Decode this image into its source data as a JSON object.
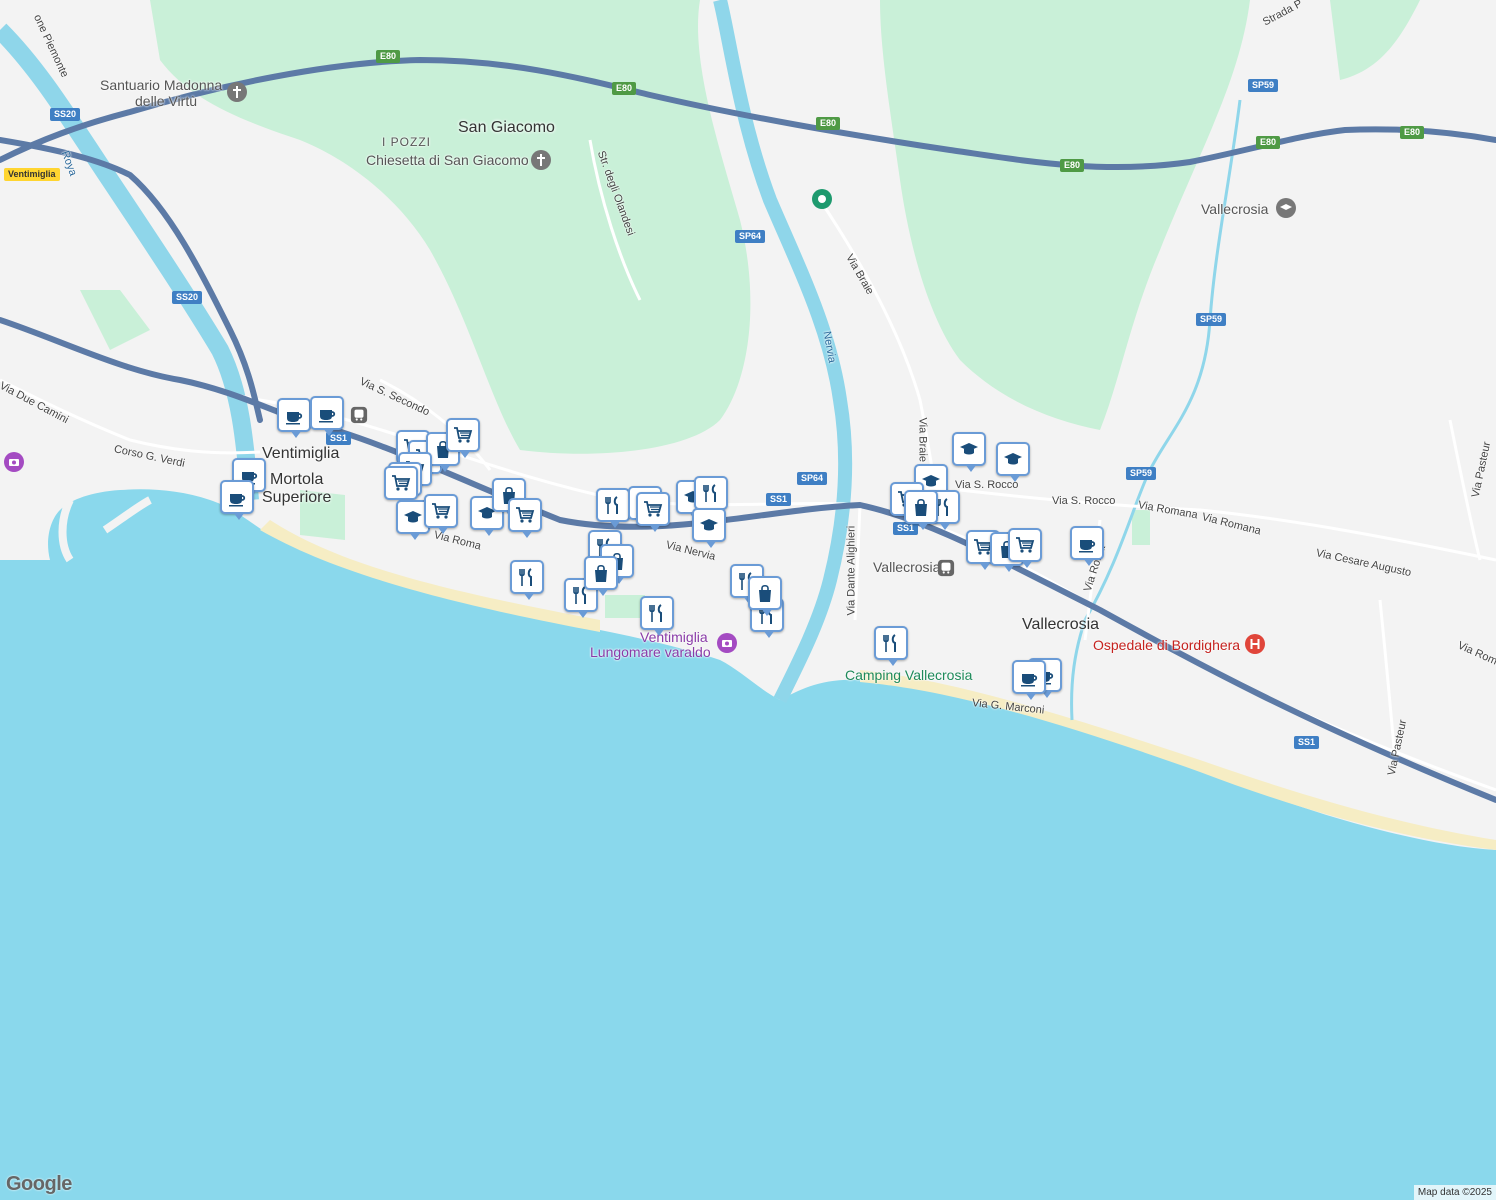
{
  "map": {
    "colors": {
      "sea": "#8ad8ec",
      "land": "#f3f3f3",
      "forest": "#c9f0d8",
      "river": "#8fd6ea",
      "highway": "#5c7aa6",
      "road": "#ffffff",
      "beach": "#f6edc4",
      "marker_border": "#6a9bd6",
      "marker_icon": "#1a4d7a"
    },
    "places": [
      {
        "name": "Ventimiglia",
        "kind": "city"
      },
      {
        "name": "Mortola",
        "kind": "town"
      },
      {
        "name": "Superiore",
        "kind": "town"
      },
      {
        "name": "San Giacomo",
        "kind": "town"
      },
      {
        "name": "I POZZI",
        "kind": "area"
      },
      {
        "name": "Vallecrosia",
        "kind": "city"
      }
    ],
    "pois": [
      {
        "name": "Santuario Madonna",
        "icon": "church-icon"
      },
      {
        "name": "delle Virtù",
        "icon": "church-icon"
      },
      {
        "name": "Chiesetta di San Giacomo",
        "icon": "church-icon"
      },
      {
        "name": "Vallecrosia",
        "icon": "school-icon"
      },
      {
        "name": "Ventimiglia",
        "icon": "camera-icon"
      },
      {
        "name": "Lungomare varaldo",
        "icon": "camera-icon"
      },
      {
        "name": "Ospedale di Bordighera",
        "icon": "hospital-icon"
      },
      {
        "name": "Camping Vallecrosia",
        "icon": "camping-icon"
      },
      {
        "name": "Vallecrosia",
        "icon": "train-station-icon"
      }
    ],
    "streets": [
      "Via Due Camini",
      "Corso G. Verdi",
      "Via S. Secondo",
      "Via Roma",
      "Via Nervia",
      "Str. degli Olandesi",
      "Via Braie",
      "Via Braie",
      "Via Dante Alighieri",
      "Via S. Rocco",
      "Via S. Rocco",
      "Via Romana",
      "Via Romana",
      "Via Cesare Augusto",
      "Via G. Marconi",
      "Via Pasteur",
      "Via Pasteur",
      "Via Roma",
      "Strada P",
      "Nervia",
      "Roya",
      "one Piemonte",
      "Via Roma"
    ],
    "shields": [
      {
        "label": "E80",
        "color": "green"
      },
      {
        "label": "E80",
        "color": "green"
      },
      {
        "label": "E80",
        "color": "green"
      },
      {
        "label": "E80",
        "color": "green"
      },
      {
        "label": "E80",
        "color": "green"
      },
      {
        "label": "E80",
        "color": "green"
      },
      {
        "label": "SS20",
        "color": "blue"
      },
      {
        "label": "SS20",
        "color": "blue"
      },
      {
        "label": "SS1",
        "color": "blue"
      },
      {
        "label": "SS1",
        "color": "blue"
      },
      {
        "label": "SS1",
        "color": "blue"
      },
      {
        "label": "SS1",
        "color": "blue"
      },
      {
        "label": "SP64",
        "color": "blue"
      },
      {
        "label": "SP64",
        "color": "blue"
      },
      {
        "label": "SP59",
        "color": "blue"
      },
      {
        "label": "SP59",
        "color": "blue"
      },
      {
        "label": "SP59",
        "color": "blue"
      },
      {
        "label": "Ventimiglia",
        "color": "yellow"
      }
    ],
    "markers": [
      "cafe",
      "cafe",
      "cafe",
      "cafe",
      "shopping",
      "shopping",
      "shopping",
      "shopping",
      "shopping",
      "shopping",
      "shopping",
      "school",
      "school",
      "shopping",
      "restaurant",
      "shopping",
      "shopping",
      "school",
      "restaurant",
      "restaurant",
      "shopping",
      "restaurant",
      "restaurant",
      "restaurant",
      "shopping",
      "restaurant",
      "school",
      "shopping",
      "restaurant",
      "restaurant",
      "school",
      "school",
      "school",
      "shopping",
      "restaurant",
      "shopping",
      "shopping",
      "shopping",
      "cafe",
      "shopping",
      "shopping",
      "restaurant",
      "cafe",
      "cafe"
    ],
    "attribution": "Map data ©2025",
    "logo": "Google"
  }
}
